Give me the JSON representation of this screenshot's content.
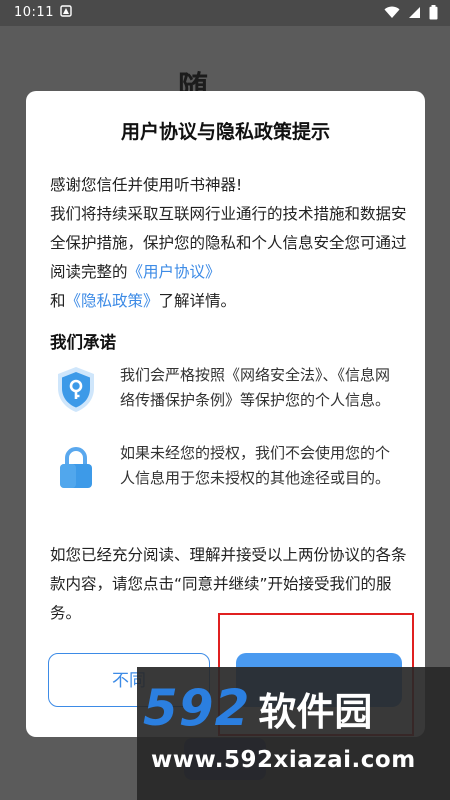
{
  "statusbar": {
    "time": "10:11",
    "icons": [
      "notification-icon",
      "wifi-icon",
      "signal-icon",
      "battery-icon"
    ]
  },
  "background": {
    "partial_title": "随"
  },
  "dialog": {
    "title": "用户协议与隐私政策提示",
    "intro": {
      "line1": "感谢您信任并使用听书神器!",
      "text_a": "我们将持续采取互联网行业通行的技术措施和数据安全保护措施，保护您的隐私和个人信息安全您可通过阅读完整的",
      "user_agreement_link": "《用户协议》",
      "and": "和",
      "privacy_policy_link": "《隐私政策》",
      "text_b": "了解详情。"
    },
    "section_title": "我们承诺",
    "promises": [
      {
        "icon": "shield-key-icon",
        "text": "我们会严格按照《网络安全法》、《信息网络传播保护条例》等保护您的个人信息。"
      },
      {
        "icon": "lock-icon",
        "text": "如果未经您的授权，我们不会使用您的个人信息用于您未授权的其他途径或目的。"
      }
    ],
    "closing": "如您已经充分阅读、理解并接受以上两份协议的各条款内容，请您点击“同意并继续”开始接受我们的服务。",
    "buttons": {
      "disagree_visible": "不同"
    }
  },
  "watermark": {
    "number": "592",
    "name": "软件园",
    "url": "www.592xiazai.com"
  },
  "colors": {
    "accent": "#3d8be6",
    "agree_button": "#4a9af0",
    "overlay": "#5b5b5b",
    "highlight": "#e02020",
    "watermark_blue": "#2b7fe0"
  }
}
